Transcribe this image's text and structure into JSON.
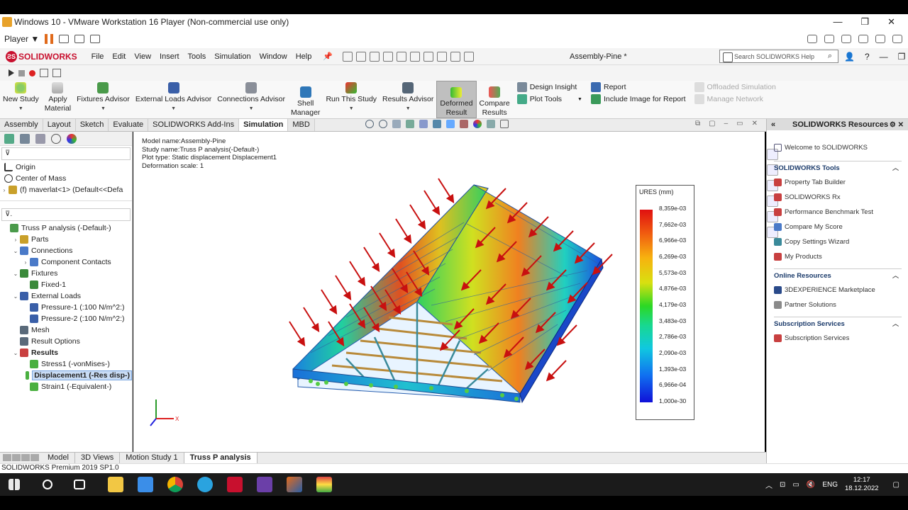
{
  "vm": {
    "title": "Windows 10 - VMware Workstation 16 Player (Non-commercial use only)",
    "player_label": "Player ▼",
    "win_min": "—",
    "win_max": "❐",
    "win_close": "✕"
  },
  "sw": {
    "logo": "SOLIDWORKS",
    "menu": [
      "File",
      "Edit",
      "View",
      "Insert",
      "Tools",
      "Simulation",
      "Window",
      "Help"
    ],
    "doc_title": "Assembly-Pine *",
    "search_placeholder": "Search SOLIDWORKS Help",
    "menu_right": [
      "👤",
      "?",
      "—",
      "❐",
      "✕"
    ]
  },
  "ribbon": {
    "new_study": "New Study",
    "apply_material": [
      "Apply",
      "Material"
    ],
    "fixtures_advisor": "Fixtures Advisor",
    "external_loads_advisor": "External Loads Advisor",
    "connections_advisor": "Connections Advisor",
    "shell_manager": [
      "Shell",
      "Manager"
    ],
    "run_this_study": "Run This Study",
    "results_advisor": "Results Advisor",
    "deformed_result": [
      "Deformed",
      "Result"
    ],
    "compare_results": [
      "Compare",
      "Results"
    ],
    "design_insight": "Design Insight",
    "plot_tools": "Plot Tools",
    "report": "Report",
    "include_image": "Include Image for Report",
    "offloaded_simulation": "Offloaded Simulation",
    "manage_network": "Manage Network"
  },
  "tabs": [
    "Assembly",
    "Layout",
    "Sketch",
    "Evaluate",
    "SOLIDWORKS Add-Ins",
    "Simulation",
    "MBD"
  ],
  "active_tab": "Simulation",
  "tree_top": [
    {
      "label": "Origin"
    },
    {
      "label": "Center of Mass"
    },
    {
      "label": "(f) maverlat<1> (Default<<Defa"
    }
  ],
  "tree": [
    {
      "label": "Truss P analysis (-Default-)",
      "level": 0,
      "exp": ""
    },
    {
      "label": "Parts",
      "level": 1,
      "exp": "›"
    },
    {
      "label": "Connections",
      "level": 1,
      "exp": "⌄"
    },
    {
      "label": "Component Contacts",
      "level": 2,
      "exp": "›"
    },
    {
      "label": "Fixtures",
      "level": 1,
      "exp": "⌄"
    },
    {
      "label": "Fixed-1",
      "level": 2,
      "exp": ""
    },
    {
      "label": "External Loads",
      "level": 1,
      "exp": "⌄"
    },
    {
      "label": "Pressure-1 (:100 N/m^2:)",
      "level": 2,
      "exp": ""
    },
    {
      "label": "Pressure-2 (:100 N/m^2:)",
      "level": 2,
      "exp": ""
    },
    {
      "label": "Mesh",
      "level": 1,
      "exp": ""
    },
    {
      "label": "Result Options",
      "level": 1,
      "exp": ""
    },
    {
      "label": "Results",
      "level": 1,
      "exp": "⌄"
    },
    {
      "label": "Stress1 (-vonMises-)",
      "level": 2,
      "exp": ""
    },
    {
      "label": "Displacement1 (-Res disp-)",
      "level": 2,
      "exp": ""
    },
    {
      "label": "Strain1 (-Equivalent-)",
      "level": 2,
      "exp": ""
    }
  ],
  "viewport": {
    "model_name": "Model name:Assembly-Pine",
    "study_name": "Study name:Truss P analysis(-Default-)",
    "plot_type": "Plot type: Static displacement Displacement1",
    "deformation_scale": "Deformation scale: 1"
  },
  "legend": {
    "title": "URES (mm)",
    "values": [
      "8,359e-03",
      "7,662e-03",
      "6,966e-03",
      "6,269e-03",
      "5,573e-03",
      "4,876e-03",
      "4,179e-03",
      "3,483e-03",
      "2,786e-03",
      "2,090e-03",
      "1,393e-03",
      "6,966e-04",
      "1,000e-30"
    ],
    "colors": [
      "#e01010",
      "#f05a10",
      "#f7b20f",
      "#d8e010",
      "#2cd824",
      "#18d890",
      "#10c8e0",
      "#1070f0",
      "#1010d8"
    ]
  },
  "bottom_tabs": [
    "Model",
    "3D Views",
    "Motion Study 1",
    "Truss P analysis"
  ],
  "status": "SOLIDWORKS Premium 2019 SP1.0",
  "task_pane": {
    "title": "SOLIDWORKS Resources",
    "welcome": "Welcome to SOLIDWORKS",
    "tools_header": "SOLIDWORKS Tools",
    "tools": [
      "Property Tab Builder",
      "SOLIDWORKS Rx",
      "Performance Benchmark Test",
      "Compare My Score",
      "Copy Settings Wizard",
      "My Products"
    ],
    "online_header": "Online Resources",
    "online": [
      "3DEXPERIENCE Marketplace",
      "Partner Solutions"
    ],
    "subs_header": "Subscription Services",
    "subs": [
      "Subscription Services"
    ]
  },
  "taskbar": {
    "lang": "ENG",
    "time": "12:17",
    "date": "18.12.2022"
  }
}
